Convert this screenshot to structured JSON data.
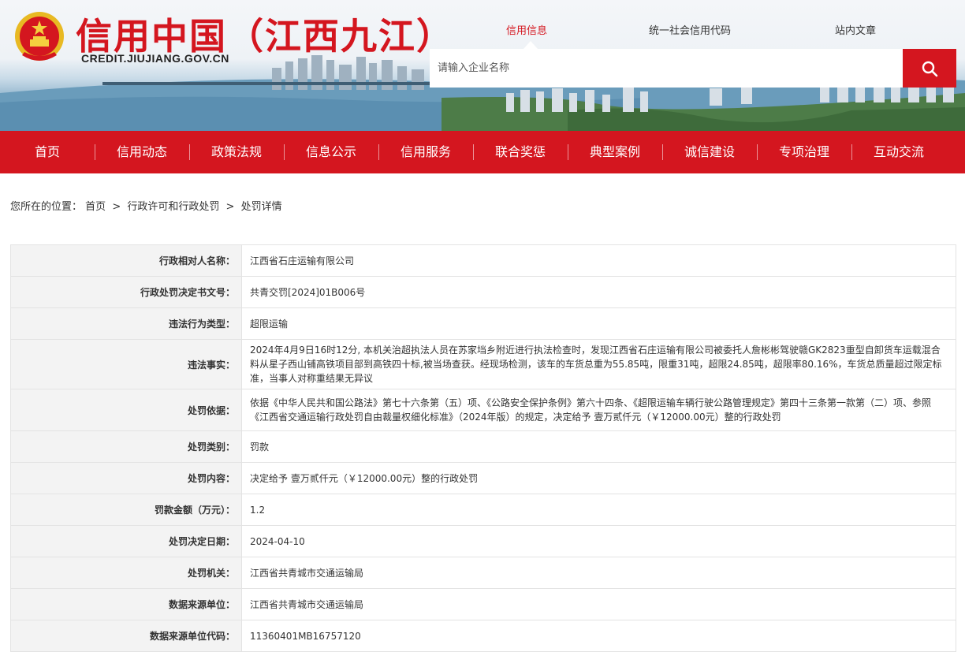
{
  "site": {
    "title": "信用中国（江西九江）",
    "domain": "CREDIT.JIUJIANG.GOV.CN",
    "emblem_icon": "national-emblem-icon",
    "brand_color": "#d4161f"
  },
  "search": {
    "tabs": [
      "信用信息",
      "统一社会信用代码",
      "站内文章"
    ],
    "active_tab": "信用信息",
    "placeholder": "请输入企业名称",
    "button_icon": "search-icon"
  },
  "nav": {
    "items": [
      "首页",
      "信用动态",
      "政策法规",
      "信息公示",
      "信用服务",
      "联合奖惩",
      "典型案例",
      "诚信建设",
      "专项治理",
      "互动交流"
    ]
  },
  "breadcrumb": {
    "prefix": "您所在的位置：",
    "items": [
      "首页",
      "行政许可和行政处罚",
      "处罚详情"
    ],
    "separator": ">"
  },
  "detail": {
    "rows": [
      {
        "label": "行政相对人名称：",
        "value": "江西省石庄运输有限公司"
      },
      {
        "label": "行政处罚决定书文号：",
        "value": "共青交罚[2024]01B006号"
      },
      {
        "label": "违法行为类型：",
        "value": "超限运输"
      },
      {
        "label": "违法事实：",
        "value": "2024年4月9日16时12分, 本机关治超执法人员在苏家垱乡附近进行执法检查时，发现江西省石庄运输有限公司被委托人詹彬彬驾驶赣GK2823重型自卸货车运载混合料从星子西山铺高铁项目部到高铁四十标,被当场查获。经现场检测，该车的车货总重为55.85吨，限重31吨，超限24.85吨，超限率80.16%，车货总质量超过限定标准，当事人对称重结果无异议"
      },
      {
        "label": "处罚依据：",
        "value": "依据《中华人民共和国公路法》第七十六条第（五）项、《公路安全保护条例》第六十四条、《超限运输车辆行驶公路管理规定》第四十三条第一款第（二）项、参照《江西省交通运输行政处罚自由裁量权细化标准》（2024年版）的规定，决定给予 壹万贰仟元（￥12000.00元）整的行政处罚"
      },
      {
        "label": "处罚类别：",
        "value": "罚款"
      },
      {
        "label": "处罚内容：",
        "value": "决定给予 壹万贰仟元（￥12000.00元）整的行政处罚"
      },
      {
        "label": "罚款金额（万元）：",
        "value": "1.2"
      },
      {
        "label": "处罚决定日期：",
        "value": "2024-04-10"
      },
      {
        "label": "处罚机关：",
        "value": "江西省共青城市交通运输局"
      },
      {
        "label": "数据来源单位：",
        "value": "江西省共青城市交通运输局"
      },
      {
        "label": "数据来源单位代码：",
        "value": "11360401MB16757120"
      }
    ]
  }
}
